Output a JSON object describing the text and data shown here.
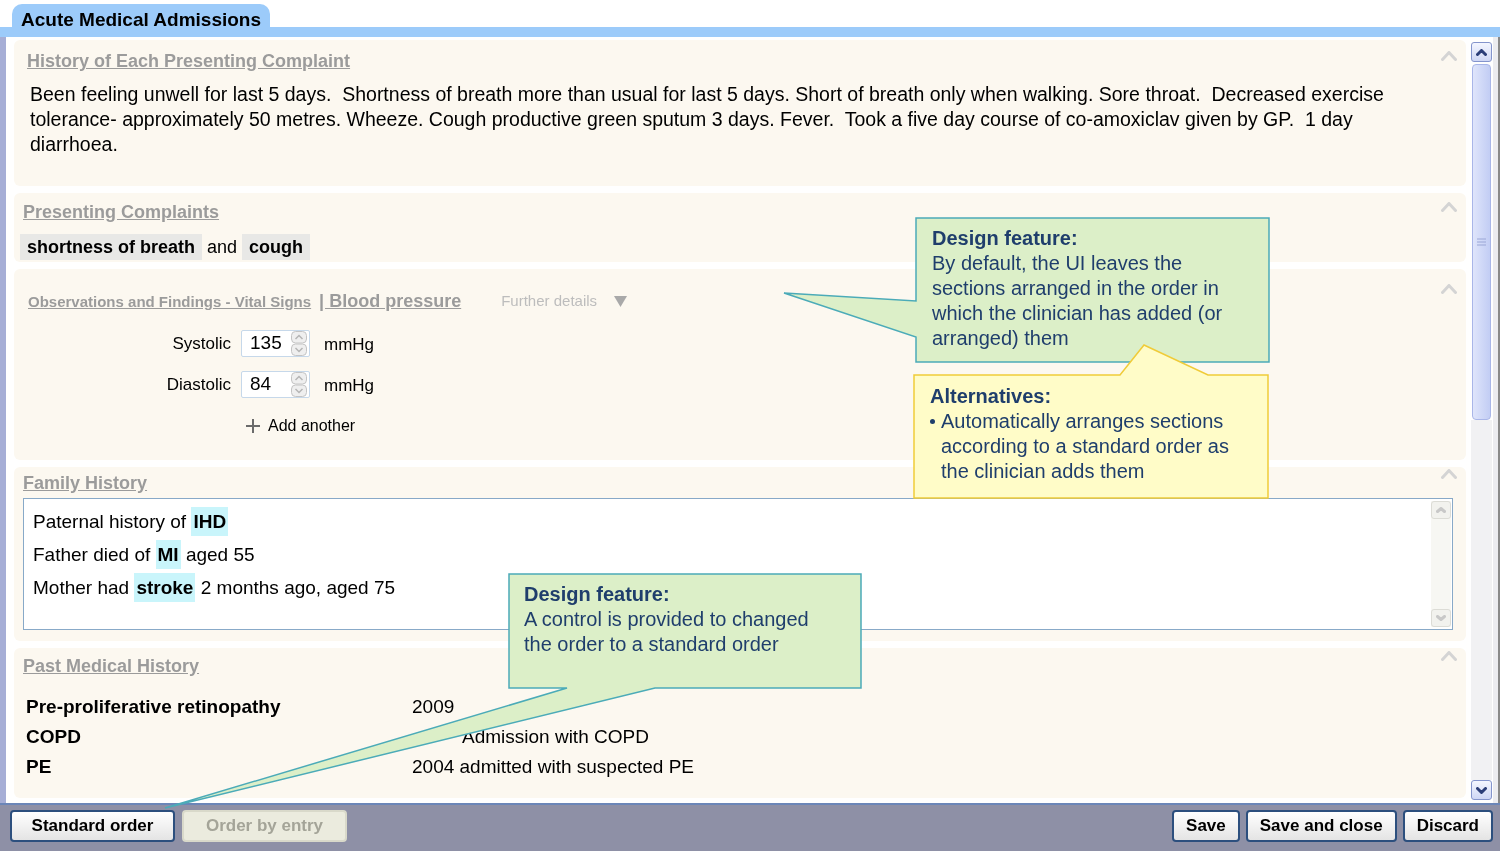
{
  "tab": {
    "title": "Acute Medical Admissions"
  },
  "sections": [
    {
      "kind": "narrative",
      "heading": "History of Each Presenting Complaint",
      "text": "Been feeling unwell for last 5 days.  Shortness of breath more than usual for last 5 days. Short of breath only when walking. Sore throat.  Decreased exercise tolerance- approximately 50 metres. Wheeze. Cough productive green sputum 3 days. Fever.  Took a five day course of co-amoxiclav given by GP.  1 day diarrhoea."
    },
    {
      "kind": "complaints",
      "heading": "Presenting Complaints",
      "text": "**shortness of breath** and **cough**"
    },
    {
      "kind": "observations",
      "heading": "Observations and Findings - Vital Signs",
      "subheading": "| Blood pressure",
      "details_label": "Further details",
      "fields": [
        {
          "label": "Systolic",
          "value": "135",
          "unit": "mmHg"
        },
        {
          "label": "Diastolic",
          "value": "84",
          "unit": "mmHg"
        }
      ],
      "add_label": "Add another"
    },
    {
      "kind": "notes",
      "heading": "Family History",
      "lines": [
        "Paternal history of **IHD**",
        "Father died of **MI** aged 55",
        "Mother had **stroke** 2 months ago, aged 75"
      ]
    },
    {
      "kind": "table",
      "heading": "Past Medical History",
      "rows": [
        {
          "condition": "Pre-proliferative retinopathy",
          "detail": "2009",
          "obscured": false
        },
        {
          "condition": "COPD",
          "detail": "Admission with COPD",
          "obscured": true
        },
        {
          "condition": "PE",
          "detail": "2004 admitted with suspected PE",
          "obscured": false
        }
      ]
    }
  ],
  "order_buttons": [
    {
      "label": "Standard order",
      "disabled": false
    },
    {
      "label": "Order by entry",
      "disabled": true
    }
  ],
  "actions": [
    "Save",
    "Save and close",
    "Discard"
  ],
  "callouts": [
    {
      "kind": "design",
      "heading": "Design feature:",
      "text": "By default, the UI leaves the sections arranged in the order in which the clinician has added (or arranged) them"
    },
    {
      "kind": "alternatives",
      "heading": "Alternatives:",
      "bullets": [
        "Automatically arranges sections according to a standard order as the clinician adds them"
      ]
    },
    {
      "kind": "design",
      "heading": "Design feature:",
      "text": "A control is provided to changed the order to a standard order"
    }
  ]
}
